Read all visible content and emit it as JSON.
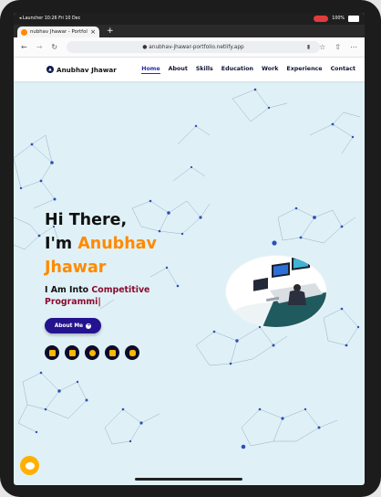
{
  "status_bar": {
    "left": "◂ Launcher   10:26   Fri 10 Dec",
    "battery": "100%"
  },
  "browser": {
    "tab_title": "nubhav Jhawar - Portfolio",
    "close_glyph": "×",
    "new_tab_glyph": "+",
    "url": "anubhav-jhawar-portfolio.netlify.app",
    "icons": [
      "back-icon",
      "forward-icon",
      "reload-icon",
      "lock-icon",
      "mic-icon",
      "star-icon",
      "share-icon",
      "more-icon"
    ]
  },
  "navbar": {
    "brand": "Anubhav Jhawar",
    "menu": [
      "Home",
      "About",
      "Skills",
      "Education",
      "Work",
      "Experience",
      "Contact"
    ],
    "active": "Home"
  },
  "hero": {
    "greeting": "Hi There,",
    "im": "I'm ",
    "first_name": "Anubhav",
    "last_name": "Jhawar",
    "typed_prefix": "I Am Into ",
    "typed_text": "Competitive Programmi|",
    "button_label": "About Me",
    "social_icons": [
      "github-icon",
      "linkedin-icon",
      "github-icon",
      "mail-icon",
      "instagram-icon"
    ]
  },
  "colors": {
    "accent": "#ff8a00",
    "primary": "#24138f",
    "background": "#dff1f6",
    "typed": "#8b0b2e",
    "social_icon": "#ffb703"
  }
}
